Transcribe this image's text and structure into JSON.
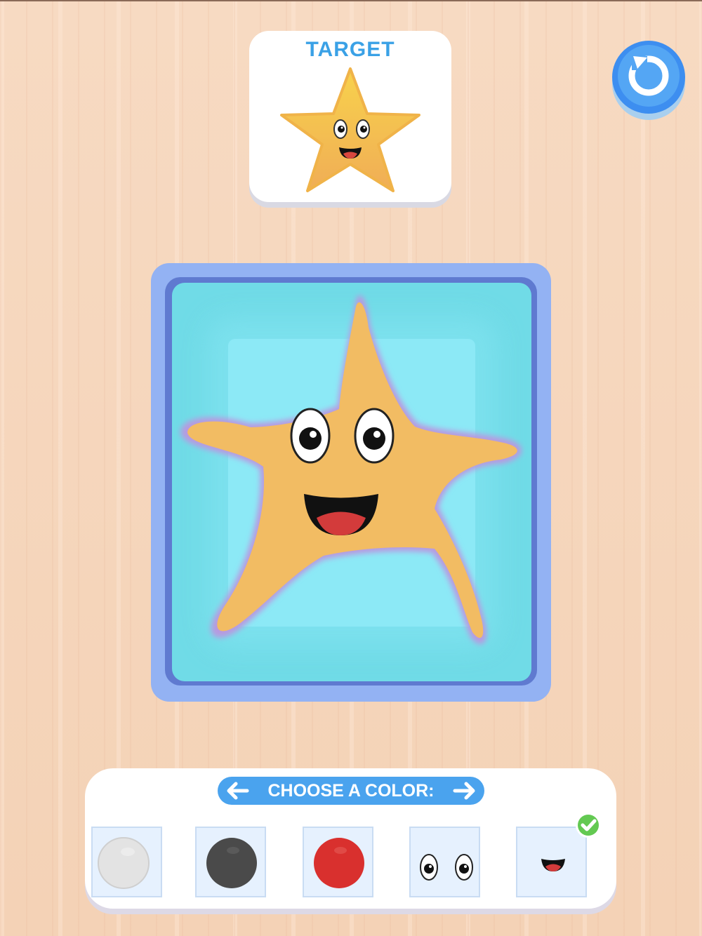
{
  "target": {
    "title": "TARGET",
    "shape_icon": "smiling-star-icon",
    "fill_color": "#f3bb3c"
  },
  "reset_button": {
    "icon": "restart-icon",
    "color": "#3d8ef0"
  },
  "canvas": {
    "tray_color": "#93b2f3",
    "water_color": "#70dbe7",
    "shape_icon": "smiling-starfish-icon",
    "shape_color": "#f2bc63"
  },
  "palette": {
    "header_label": "CHOOSE A COLOR:",
    "prev_icon": "arrow-left-icon",
    "next_icon": "arrow-right-icon",
    "swatches": [
      {
        "name": "white",
        "color": "#e3e3e3",
        "type": "color"
      },
      {
        "name": "dark-gray",
        "color": "#4a4a4a",
        "type": "color"
      },
      {
        "name": "red",
        "color": "#d9302e",
        "type": "color"
      },
      {
        "name": "eyes",
        "icon": "eyes-icon",
        "type": "sticker"
      },
      {
        "name": "mouth",
        "icon": "mouth-icon",
        "type": "sticker",
        "selected": true
      }
    ],
    "selected_icon": "checkmark-icon",
    "accent": "#4aa3ee"
  }
}
